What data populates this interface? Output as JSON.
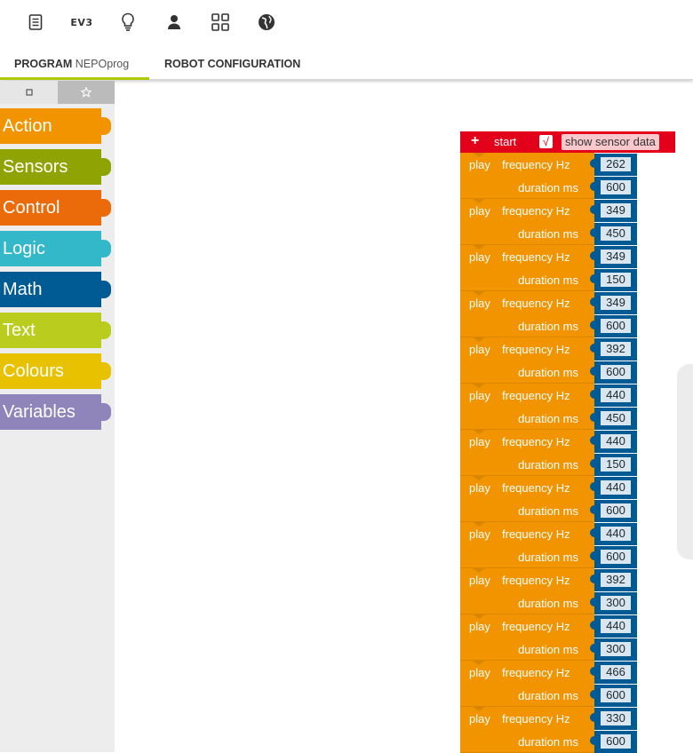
{
  "topbar": {
    "icons": [
      "program-list-icon",
      "ev3-robot-icon",
      "lightbulb-icon",
      "user-icon",
      "gallery-icon",
      "globe-icon"
    ],
    "ev3_label": "EV3"
  },
  "tabs": {
    "program_label": "PROGRAM",
    "program_name": "NEPOprog",
    "robot_config_label": "ROBOT CONFIGURATION",
    "active_color": "#afca04"
  },
  "toolbox": {
    "categories": [
      {
        "label": "Action",
        "color": "#f29400"
      },
      {
        "label": "Sensors",
        "color": "#8fa402"
      },
      {
        "label": "Control",
        "color": "#eb6a0a"
      },
      {
        "label": "Logic",
        "color": "#33b8ca"
      },
      {
        "label": "Math",
        "color": "#005a94"
      },
      {
        "label": "Text",
        "color": "#bacc1e"
      },
      {
        "label": "Colours",
        "color": "#e8c200"
      },
      {
        "label": "Variables",
        "color": "#9085ba"
      }
    ]
  },
  "program": {
    "start": {
      "plus": "+",
      "label": "start",
      "checkmark": "√",
      "show_sensor_label": "show sensor data"
    },
    "play_label": "play",
    "frequency_label": "frequency Hz",
    "duration_label": "duration ms",
    "notes": [
      {
        "frequency": "262",
        "duration": "600"
      },
      {
        "frequency": "349",
        "duration": "450"
      },
      {
        "frequency": "349",
        "duration": "150"
      },
      {
        "frequency": "349",
        "duration": "600"
      },
      {
        "frequency": "392",
        "duration": "600"
      },
      {
        "frequency": "440",
        "duration": "450"
      },
      {
        "frequency": "440",
        "duration": "150"
      },
      {
        "frequency": "440",
        "duration": "600"
      },
      {
        "frequency": "440",
        "duration": "600"
      },
      {
        "frequency": "392",
        "duration": "300"
      },
      {
        "frequency": "440",
        "duration": "300"
      },
      {
        "frequency": "466",
        "duration": "600"
      },
      {
        "frequency": "330",
        "duration": "600"
      }
    ]
  }
}
